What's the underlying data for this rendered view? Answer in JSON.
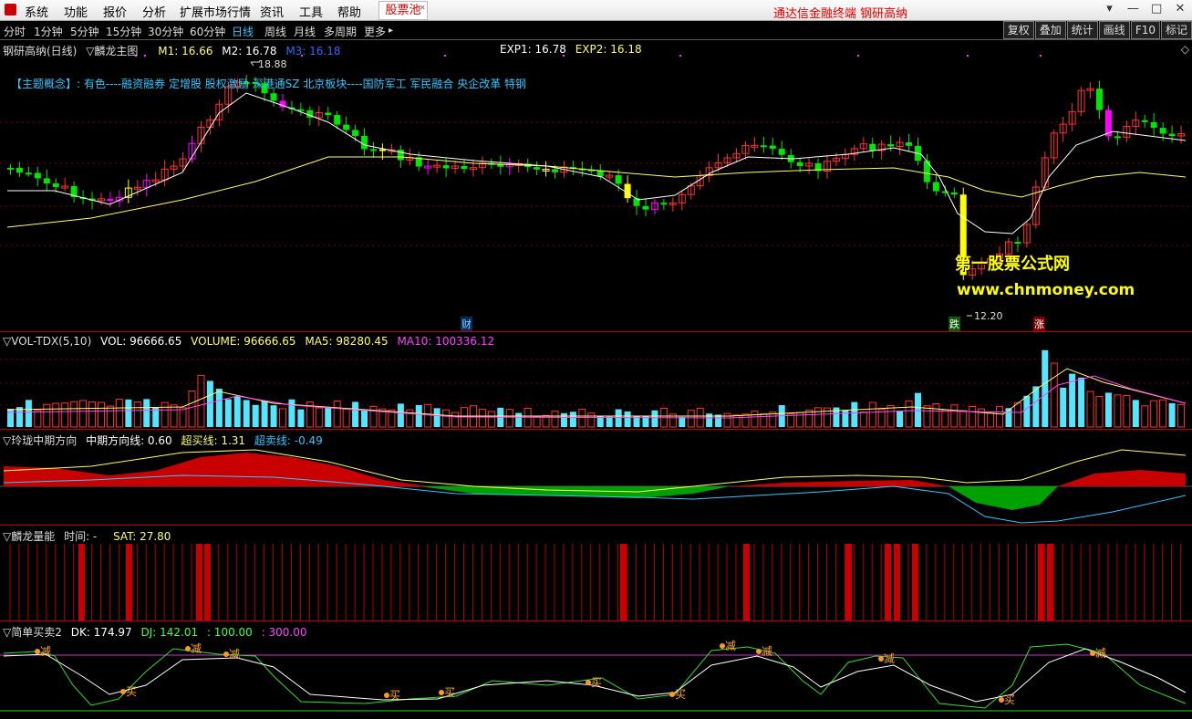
{
  "menubar": {
    "items": [
      "系统",
      "功能",
      "报价",
      "分析",
      "扩展市场行情",
      "资讯",
      "工具",
      "帮助"
    ],
    "stock_pool": "股票池",
    "brand": "通达信金融终端 钢研高纳",
    "window_controls": [
      "▾",
      "—",
      "□",
      "✕"
    ]
  },
  "periodbar": {
    "periods": [
      "分时",
      "1分钟",
      "5分钟",
      "15分钟",
      "30分钟",
      "60分钟",
      "日线",
      "周线",
      "月线",
      "多周期",
      "更多"
    ],
    "active": "日线",
    "more_arrow": "▸",
    "buttons": [
      "复权",
      "叠加",
      "统计",
      "画线",
      "F10",
      "标记"
    ]
  },
  "main_pane": {
    "stock_name": "钢研高纳(日线)",
    "indicator": "▽麟龙主图",
    "m1": "M1: 16.66",
    "m2": "M2: 16.78",
    "m3": "M3: 16.18",
    "exp1": "EXP1: 16.78",
    "exp2": "EXP2: 16.18",
    "concept": "【主题概念】: 有色----融资融券 定增股 股权激励 深港通SZ 北京板块----国防军工 军民融合 央企改革 特钢",
    "high_label": "18.88",
    "low_label": "12.20",
    "marker_cai": "财",
    "marker_die": "跌",
    "marker_zhang": "涨",
    "watermark1": "第一股票公式网",
    "watermark2": "www.chnmoney.com",
    "colors": {
      "up": "#ff3232",
      "down": "#00e600",
      "yellow": "#ffff00",
      "magenta": "#ff00ff",
      "ma1": "#ffffff",
      "ma2": "#ffff66"
    }
  },
  "vol_pane": {
    "name": "▽VOL-TDX(5,10)",
    "vol": "VOL: 96666.65",
    "volume": "VOLUME: 96666.65",
    "ma5": "MA5: 98280.45",
    "ma10": "MA10: 100336.12"
  },
  "mid_pane": {
    "name": "▽玲珑中期方向",
    "mid": "中期方向线: 0.60",
    "overbuy": "超买线: 1.31",
    "oversell": "超卖线: -0.49"
  },
  "energy_pane": {
    "name": "▽麟龙量能",
    "time": "时间: -",
    "sat": "SAT: 27.80"
  },
  "bs_pane": {
    "name": "▽简单买卖2",
    "dk": "DK: 174.97",
    "dj": "DJ: 142.01",
    "v100": ": 100.00",
    "v300": ": 300.00",
    "buy": "买",
    "sell": "减"
  }
}
